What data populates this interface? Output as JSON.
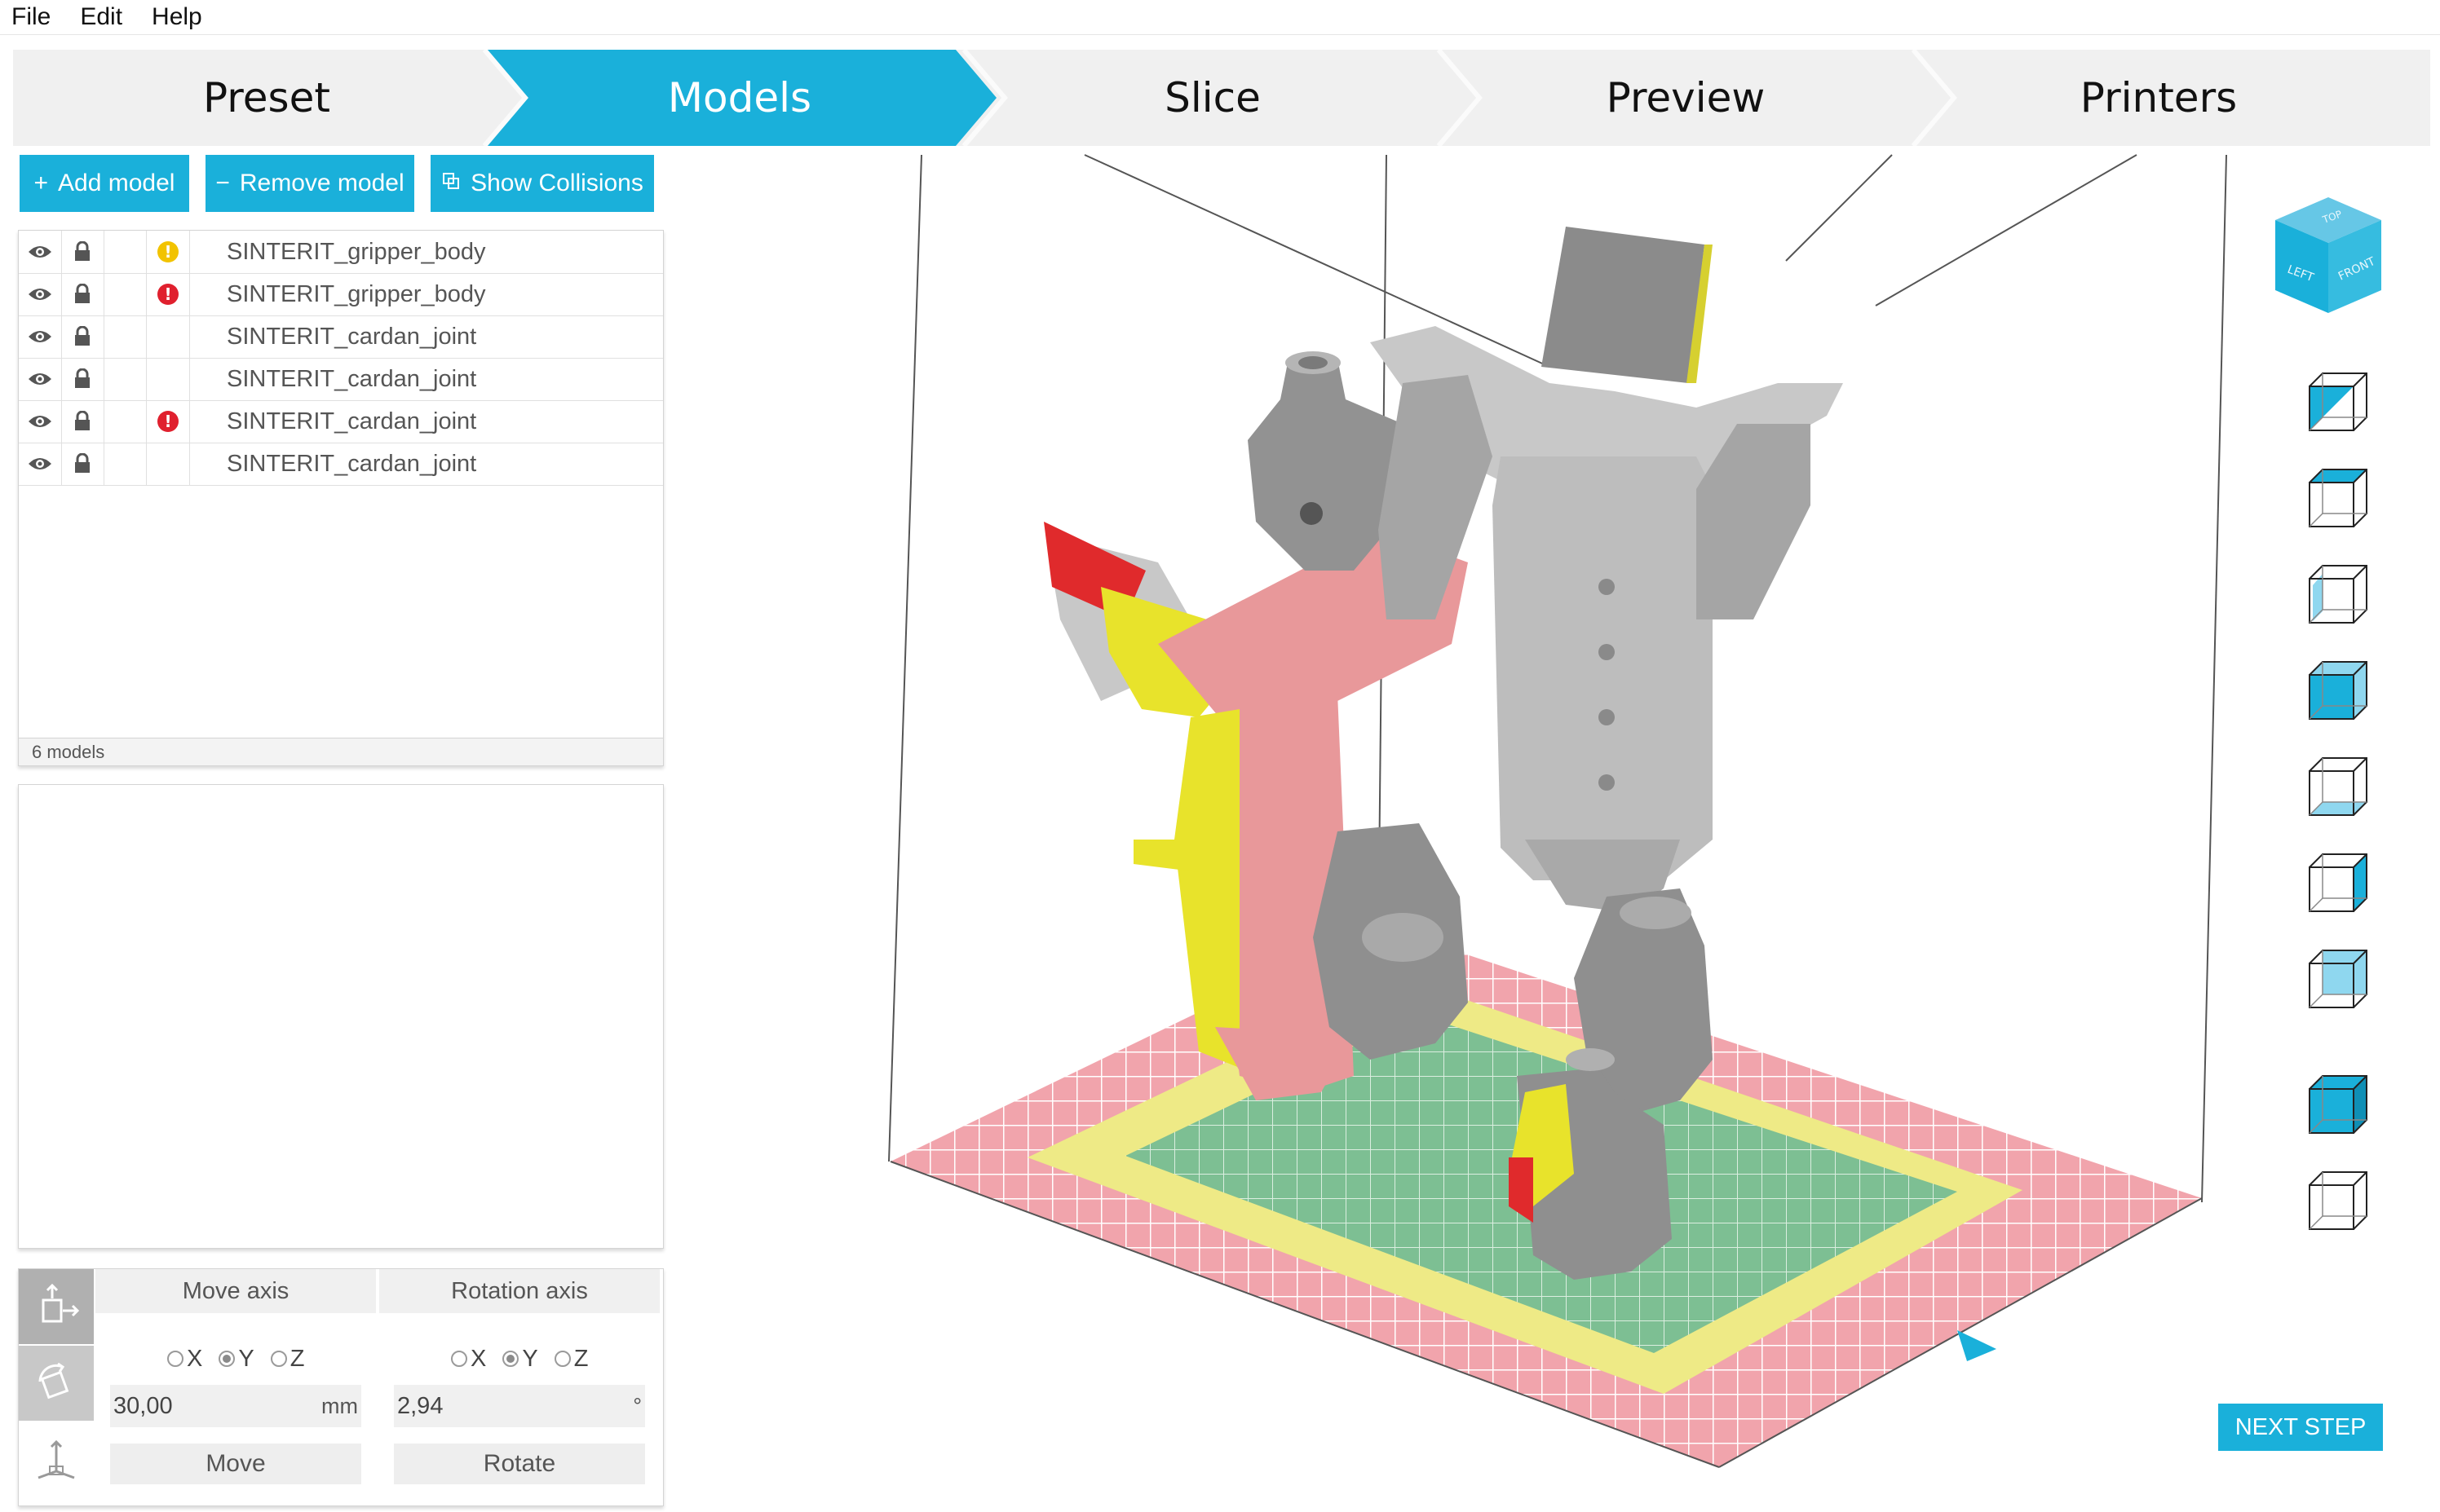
{
  "menu": {
    "file": "File",
    "edit": "Edit",
    "help": "Help"
  },
  "steps": [
    {
      "label": "Preset",
      "active": false
    },
    {
      "label": "Models",
      "active": true
    },
    {
      "label": "Slice",
      "active": false
    },
    {
      "label": "Preview",
      "active": false
    },
    {
      "label": "Printers",
      "active": false
    }
  ],
  "toolbar": {
    "add_model": "Add model",
    "remove_model": "Remove model",
    "show_collisions": "Show Collisions"
  },
  "models": [
    {
      "name": "SINTERIT_gripper_body",
      "status": "warning"
    },
    {
      "name": "SINTERIT_gripper_body",
      "status": "error"
    },
    {
      "name": "SINTERIT_cardan_joint",
      "status": "none"
    },
    {
      "name": "SINTERIT_cardan_joint",
      "status": "none"
    },
    {
      "name": "SINTERIT_cardan_joint",
      "status": "error"
    },
    {
      "name": "SINTERIT_cardan_joint",
      "status": "none"
    }
  ],
  "models_count": "6 models",
  "transform": {
    "move_axis_label": "Move axis",
    "rotation_axis_label": "Rotation axis",
    "move_axes": [
      "X",
      "Y",
      "Z"
    ],
    "move_selected": "Y",
    "rot_axes": [
      "X",
      "Y",
      "Z"
    ],
    "rot_selected": "Y",
    "move_value": "30,00",
    "move_unit": "mm",
    "rot_value": "2,94",
    "rot_unit": "°",
    "move_button": "Move",
    "rotate_button": "Rotate"
  },
  "viewcube": {
    "top": "TOP",
    "left": "LEFT",
    "front": "FRONT"
  },
  "next_step": "NEXT STEP",
  "colors": {
    "accent": "#1ab0da",
    "warning": "#f2c300",
    "error": "#e0202e",
    "collision": "#e8262c",
    "highlight_yellow": "#e9e62c",
    "model_pink": "#e8989a",
    "model_gray": "#8f8f8f"
  }
}
